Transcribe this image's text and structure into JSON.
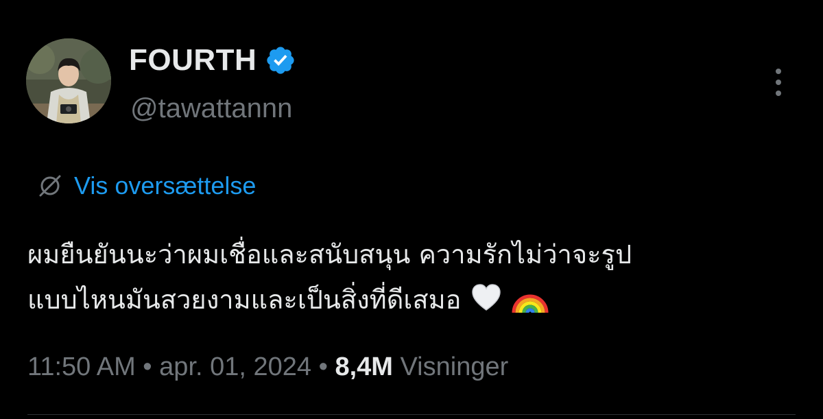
{
  "author": {
    "display_name": "FOURTH",
    "handle": "@tawattannn",
    "verified": true,
    "accent_color": "#1d9bf0"
  },
  "menu": {
    "icon": "more-vertical-icon"
  },
  "translate": {
    "label": "Vis oversættelse",
    "icon": "globe-slash-icon"
  },
  "tweet": {
    "line1": "ผมยืนยันนะว่าผมเชื่อและสนับสนุน ความรักไม่ว่าจะรูป",
    "line2": "แบบไหนมันสวยงามและเป็นสิ่งที่ดีเสมอ",
    "emojis": [
      "white-heart-icon",
      "rainbow-icon"
    ]
  },
  "meta": {
    "time": "11:50 AM",
    "separator": "•",
    "date": "apr. 01, 2024",
    "views_count": "8,4M",
    "views_label": "Visninger"
  }
}
